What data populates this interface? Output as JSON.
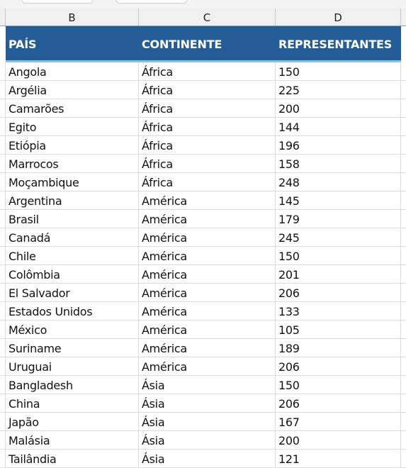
{
  "sheet": {
    "column_headers": [
      "B",
      "C",
      "D"
    ],
    "table_headers": [
      "PAÍS",
      "CONTINENTE",
      "REPRESENTANTES"
    ],
    "rows": [
      [
        "Angola",
        "África",
        "150"
      ],
      [
        "Argélia",
        "África",
        "225"
      ],
      [
        "Camarões",
        "África",
        "200"
      ],
      [
        "Egito",
        "África",
        "144"
      ],
      [
        "Etiópia",
        "África",
        "196"
      ],
      [
        "Marrocos",
        "África",
        "158"
      ],
      [
        "Moçambique",
        "África",
        "248"
      ],
      [
        "Argentina",
        "América",
        "145"
      ],
      [
        "Brasil",
        "América",
        "179"
      ],
      [
        "Canadá",
        "América",
        "245"
      ],
      [
        "Chile",
        "América",
        "150"
      ],
      [
        "Colômbia",
        "América",
        "201"
      ],
      [
        "El Salvador",
        "América",
        "206"
      ],
      [
        "Estados Unidos",
        "América",
        "133"
      ],
      [
        "México",
        "América",
        "105"
      ],
      [
        "Suriname",
        "América",
        "189"
      ],
      [
        "Uruguai",
        "América",
        "206"
      ],
      [
        "Bangladesh",
        "Ásia",
        "150"
      ],
      [
        "China",
        "Ásia",
        "206"
      ],
      [
        "Japão",
        "Ásia",
        "167"
      ],
      [
        "Malásia",
        "Ásia",
        "200"
      ],
      [
        "Tailândia",
        "Ásia",
        "121"
      ]
    ],
    "colors": {
      "header_fill": "#245c97",
      "header_text": "#ffffff",
      "header_border": "#85c4e8",
      "gridline": "#dcdcdc"
    }
  }
}
